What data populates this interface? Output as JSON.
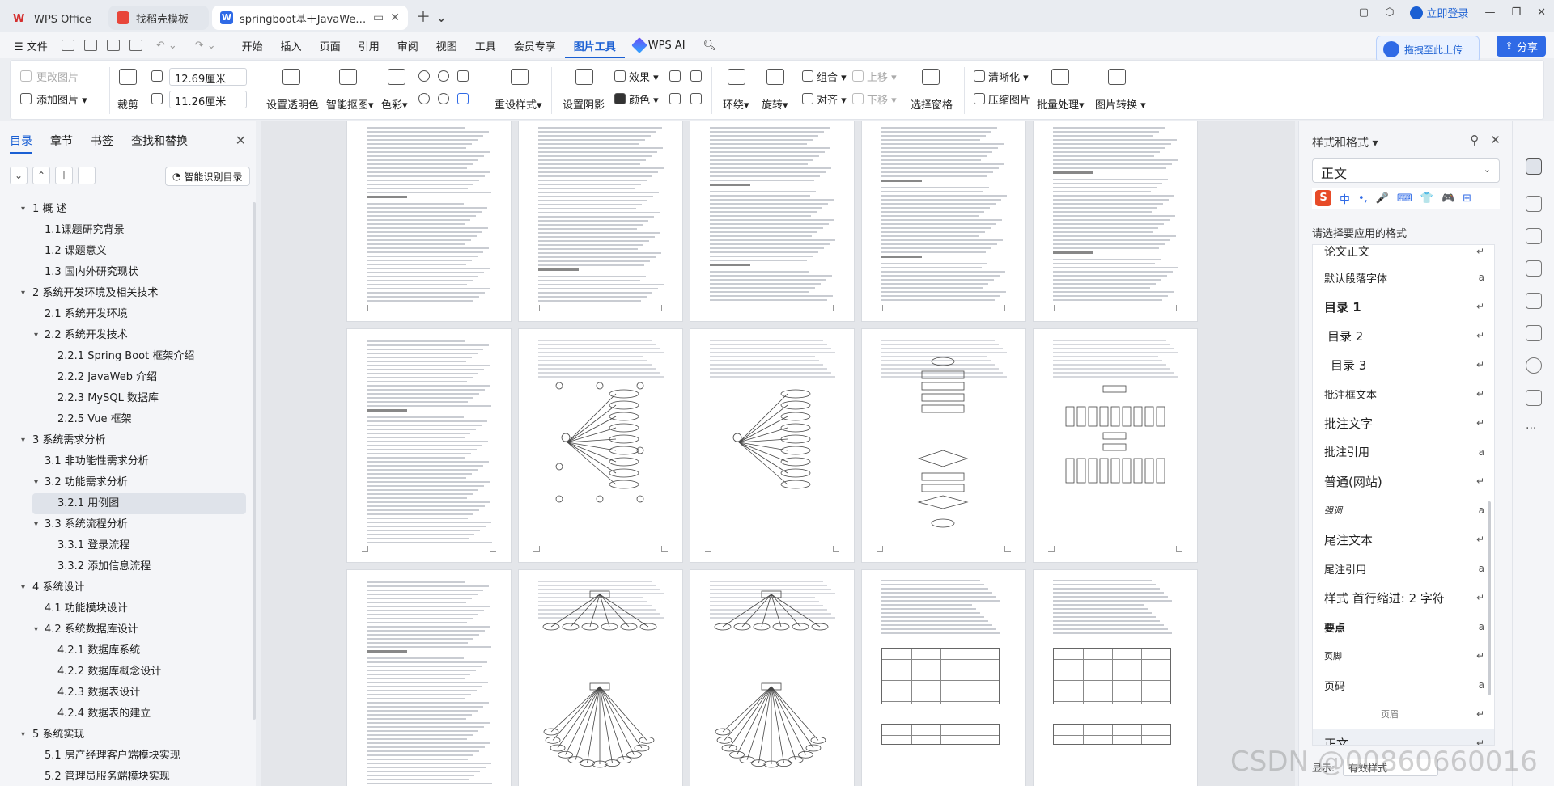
{
  "titlebar": {
    "tabs": [
      {
        "label": "WPS Office"
      },
      {
        "label": "找稻壳模板"
      },
      {
        "label": "springboot基于JavaWeb的房"
      }
    ],
    "login": "立即登录"
  },
  "menu": {
    "file": "文件",
    "items": [
      "开始",
      "插入",
      "页面",
      "引用",
      "审阅",
      "视图",
      "工具",
      "会员专享",
      "图片工具"
    ],
    "active": "图片工具",
    "wpsai": "WPS AI",
    "upload": "拖拽至此上传",
    "share": "分享"
  },
  "ribbon": {
    "change_image": "更改图片",
    "add_image": "添加图片",
    "crop": "裁剪",
    "width": "12.69厘米",
    "height": "11.26厘米",
    "transparent": "设置透明色",
    "smart_cutout": "智能抠图",
    "color": "色彩",
    "reset_style": "重设样式",
    "shadow": "设置阴影",
    "effect": "效果",
    "colors": "颜色",
    "wrap": "环绕",
    "rotate": "旋转",
    "group": "组合",
    "align": "对齐",
    "move_up": "上移",
    "move_down": "下移",
    "select_pane": "选择窗格",
    "sharpen": "清晰化",
    "compress": "压缩图片",
    "batch": "批量处理",
    "convert": "图片转换"
  },
  "leftpane": {
    "tabs": [
      "目录",
      "章节",
      "书签",
      "查找和替换"
    ],
    "ai_toc": "智能识别目录",
    "toc": [
      {
        "text": "1    概    述",
        "level": 1,
        "caret": "▾"
      },
      {
        "text": "1.1课题研究背景",
        "level": 2
      },
      {
        "text": "1.2  课题意义",
        "level": 2
      },
      {
        "text": "1.3 国内外研究现状",
        "level": 2
      },
      {
        "text": "2    系统开发环境及相关技术",
        "level": 1,
        "caret": "▾"
      },
      {
        "text": "2.1  系统开发环境",
        "level": 2
      },
      {
        "text": "2.2  系统开发技术",
        "level": 2,
        "caret": "▾"
      },
      {
        "text": "2.2.1 Spring Boot 框架介绍",
        "level": 3
      },
      {
        "text": "2.2.2 JavaWeb 介绍",
        "level": 3
      },
      {
        "text": "2.2.3 MySQL 数据库",
        "level": 3
      },
      {
        "text": "2.2.5 Vue 框架",
        "level": 3
      },
      {
        "text": "3    系统需求分析",
        "level": 1,
        "caret": "▾"
      },
      {
        "text": "3.1  非功能性需求分析",
        "level": 2
      },
      {
        "text": "3.2  功能需求分析",
        "level": 2,
        "caret": "▾"
      },
      {
        "text": "3.2.1 用例图",
        "level": 3,
        "selected": true
      },
      {
        "text": "3.3  系统流程分析",
        "level": 2,
        "caret": "▾"
      },
      {
        "text": "3.3.1  登录流程",
        "level": 3
      },
      {
        "text": "3.3.2  添加信息流程",
        "level": 3
      },
      {
        "text": "4    系统设计",
        "level": 1,
        "caret": "▾"
      },
      {
        "text": "4.1  功能模块设计",
        "level": 2
      },
      {
        "text": "4.2  系统数据库设计",
        "level": 2,
        "caret": "▾"
      },
      {
        "text": "4.2.1  数据库系统",
        "level": 3
      },
      {
        "text": "4.2.2  数据库概念设计",
        "level": 3
      },
      {
        "text": "4.2.3  数据表设计",
        "level": 3
      },
      {
        "text": "4.2.4  数据表的建立",
        "level": 3
      },
      {
        "text": "5    系统实现",
        "level": 1,
        "caret": "▾"
      },
      {
        "text": "5.1 房产经理客户端模块实现",
        "level": 2
      },
      {
        "text": "5.2 管理员服务端模块实现",
        "level": 2
      }
    ]
  },
  "rightpane": {
    "title": "样式和格式",
    "current": "正文",
    "ime": [
      "中",
      "•,",
      "🎤",
      "⌨",
      "👕",
      "🎮",
      "⊞"
    ],
    "hint": "请选择要应用的格式",
    "styles": [
      {
        "name": "论文正文",
        "mark": "↵",
        "size": 14
      },
      {
        "name": "默认段落字体",
        "mark": "a",
        "size": 13
      },
      {
        "name": "目录  1",
        "mark": "↵",
        "size": 15,
        "bold": true
      },
      {
        "name": "目录  2",
        "mark": "↵",
        "size": 15,
        "indent": 4
      },
      {
        "name": "目录  3",
        "mark": "↵",
        "size": 15,
        "indent": 8
      },
      {
        "name": "批注框文本",
        "mark": "↵",
        "size": 13
      },
      {
        "name": "批注文字",
        "mark": "↵",
        "size": 15
      },
      {
        "name": "批注引用",
        "mark": "a",
        "size": 14
      },
      {
        "name": "普通(网站)",
        "mark": "↵",
        "size": 15
      },
      {
        "name": "强调",
        "mark": "a",
        "size": 11,
        "italic": true
      },
      {
        "name": "尾注文本",
        "mark": "↵",
        "size": 15
      },
      {
        "name": "尾注引用",
        "mark": "a",
        "size": 13
      },
      {
        "name": "样式  首行缩进:   2 字符",
        "mark": "↵",
        "size": 15
      },
      {
        "name": "要点",
        "mark": "a",
        "size": 13,
        "bold": true
      },
      {
        "name": "页脚",
        "mark": "↵",
        "size": 11
      },
      {
        "name": "页码",
        "mark": "a",
        "size": 13
      },
      {
        "name": "页眉",
        "mark": "↵",
        "size": 11,
        "center": true
      },
      {
        "name": "正文",
        "mark": "↵",
        "size": 15,
        "selected": true
      }
    ],
    "footer_label": "显示:",
    "footer_value": "有效样式"
  },
  "watermark": "CSDN @00860660016",
  "colors": {
    "accent": "#1a5fd3",
    "share": "#2f6ae6"
  }
}
